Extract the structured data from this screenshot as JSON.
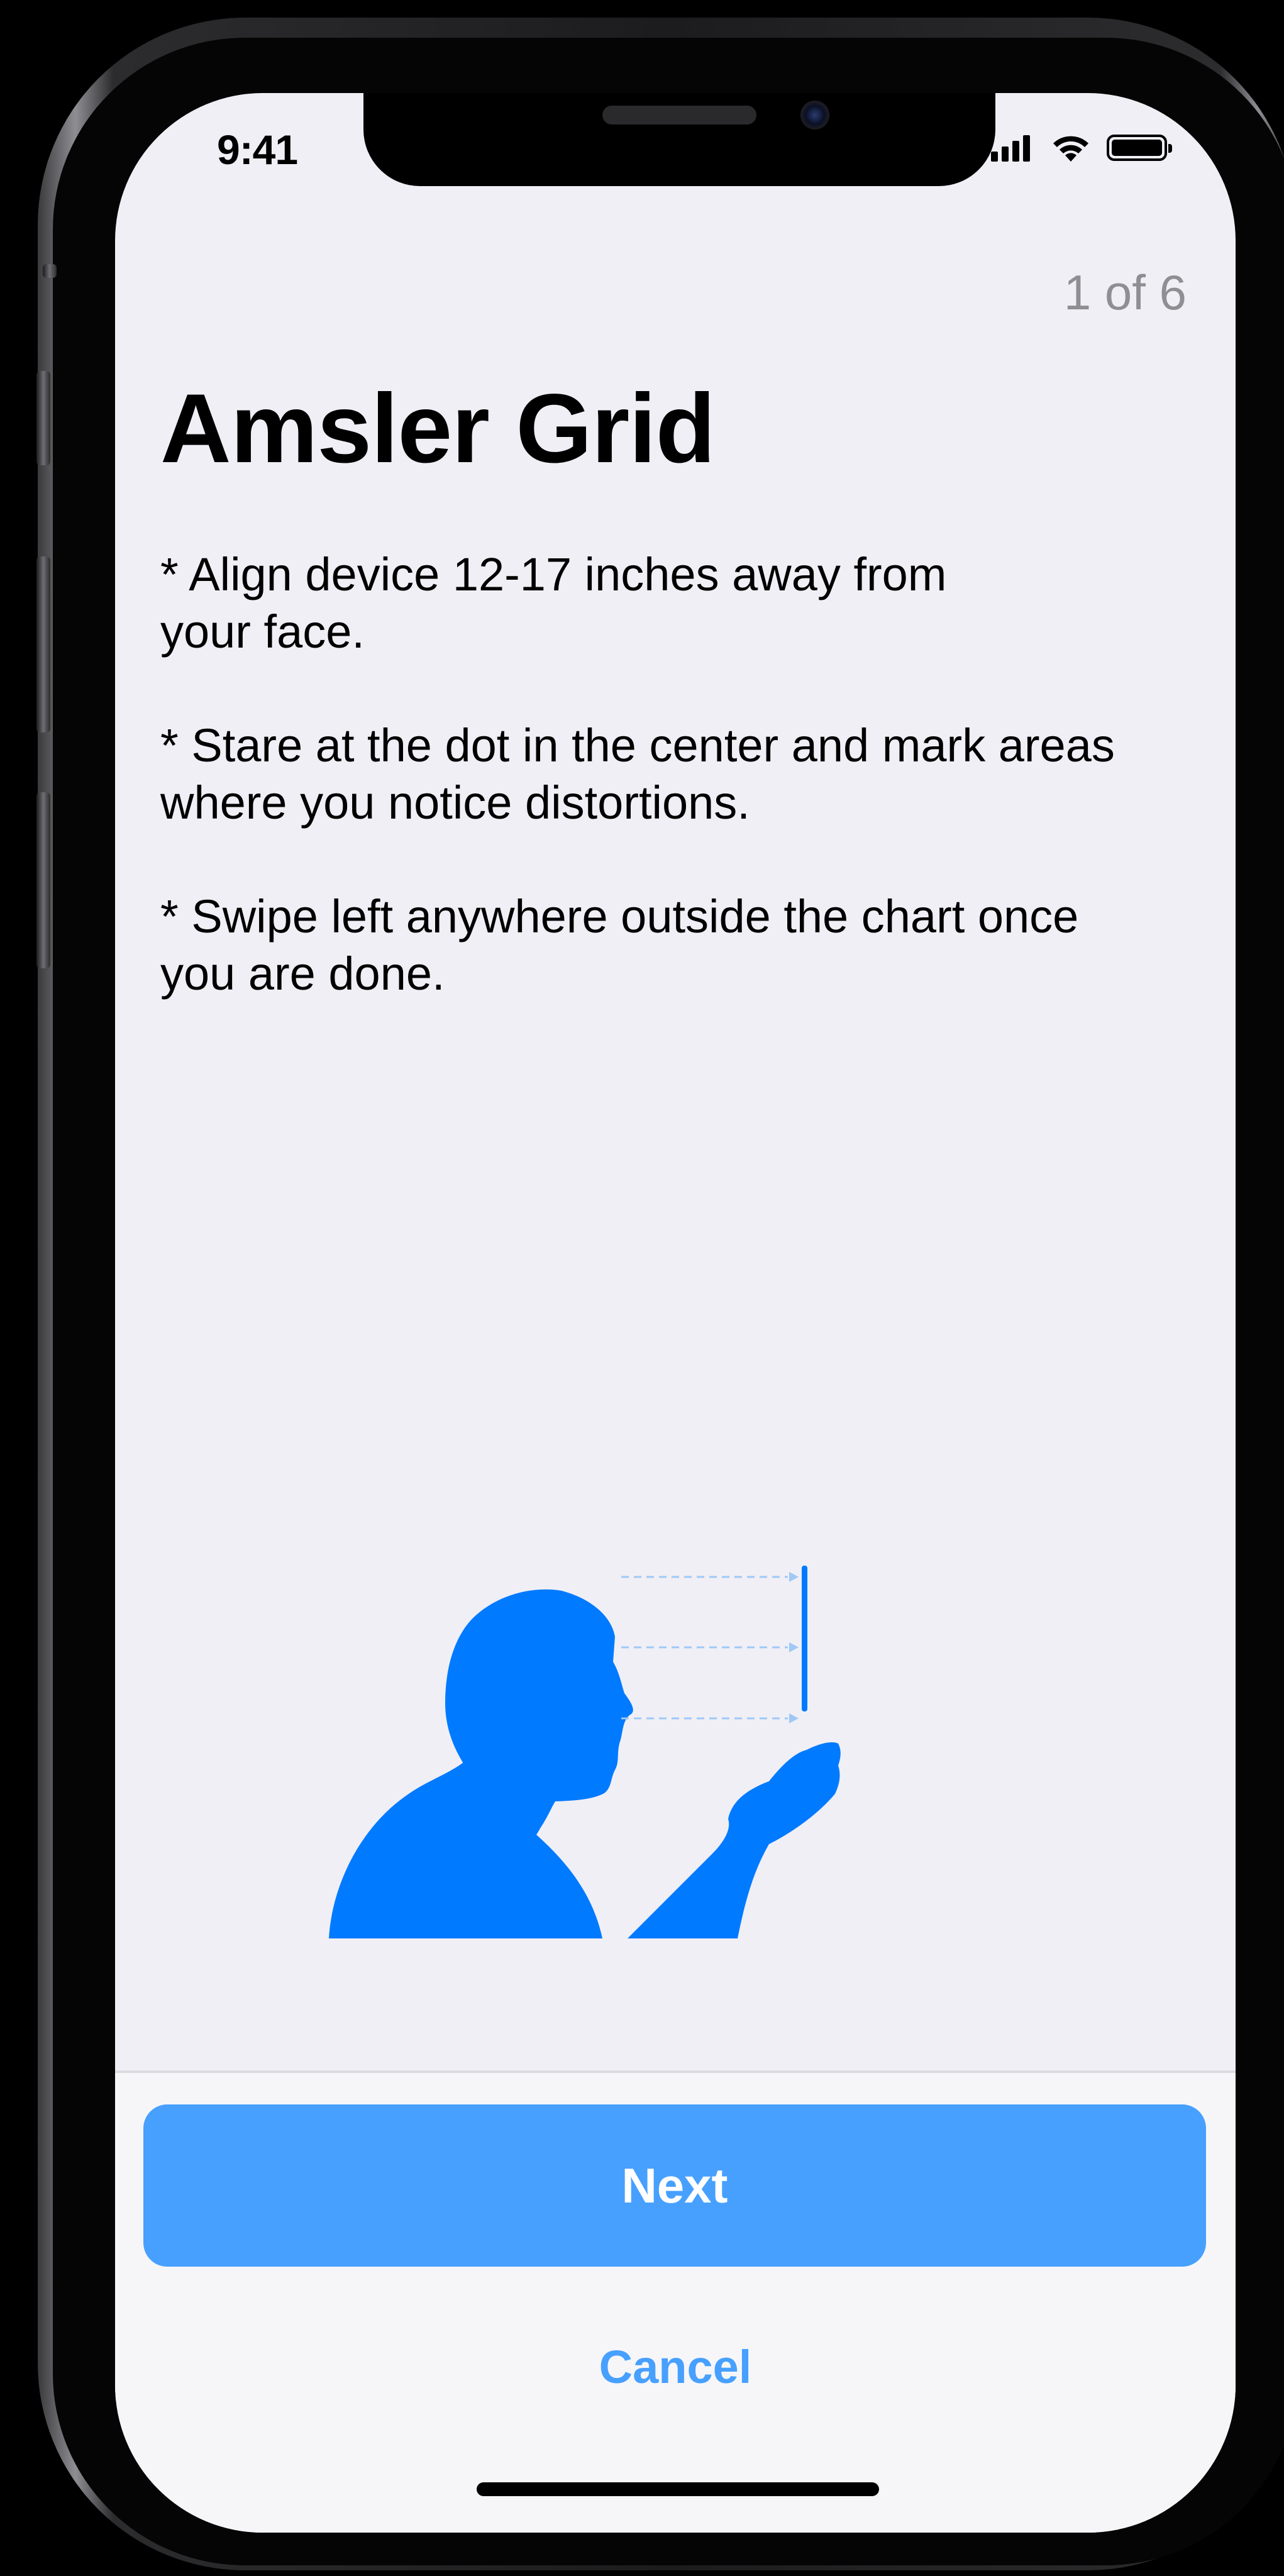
{
  "status_bar": {
    "time": "9:41",
    "signal_icon": "cellular-signal-icon",
    "wifi_icon": "wifi-icon",
    "battery_icon": "battery-icon"
  },
  "screen": {
    "step_counter": "1 of 6",
    "title": "Amsler Grid",
    "instructions": [
      "* Align device 12-17 inches away from\nyour face.",
      "* Stare at the dot in the center and mark areas\nwhere you notice distortions.",
      "* Swipe left anywhere outside the chart once\nyou are done."
    ],
    "illustration_icon": "person-holding-phone-icon"
  },
  "footer": {
    "next_label": "Next",
    "cancel_label": "Cancel"
  },
  "colors": {
    "accent": "#007aff",
    "button": "#47a0fe",
    "background": "#f0eff5",
    "secondary_text": "#8e8e93"
  }
}
